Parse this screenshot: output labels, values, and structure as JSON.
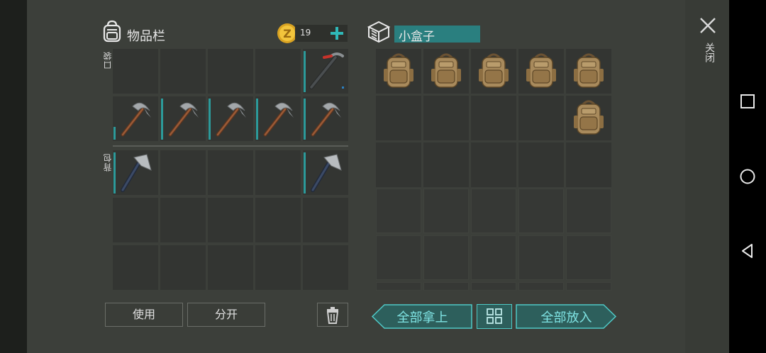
{
  "inventory": {
    "title": "物品栏",
    "coins": "19",
    "pocket_label": "口袋",
    "backpack_label": "背包"
  },
  "container": {
    "title": "小盒子"
  },
  "close": {
    "label": "关闭"
  },
  "buttons": {
    "use": "使用",
    "split": "分开",
    "take_all": "全部拿上",
    "put_all": "全部放入"
  },
  "items": {
    "crowbar": "crowbar-icon",
    "pickaxe": "pickaxe-icon",
    "axe": "axe-icon",
    "backpack": "backpack-icon"
  },
  "colors": {
    "accent": "#2c9a9a",
    "teal_text": "#7fe3e3",
    "background": "#3c3f3a",
    "slot": "#333532"
  }
}
